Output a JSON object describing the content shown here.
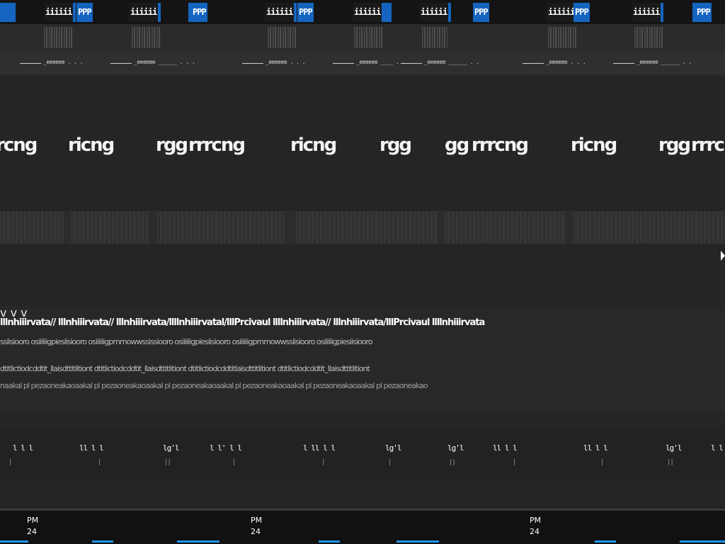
{
  "tabs": [
    {
      "label": "iiiiii"
    },
    {
      "label": "PPP"
    },
    {
      "label": "iiiiii"
    },
    {
      "label": "PPP"
    },
    {
      "label": "iiiiii"
    },
    {
      "label": "PPP"
    },
    {
      "label": "iiiiii"
    },
    {
      "label": "iiiiii"
    },
    {
      "label": "PPP"
    },
    {
      "label": "iiiiii"
    },
    {
      "label": "PPP"
    },
    {
      "label": "iiiiii"
    },
    {
      "label": "PPP"
    }
  ],
  "meta_labels": [
    "_eeeeee",
    "_eeeeee",
    "_eeeeee",
    "_eeeeee",
    "_eeeeee",
    "_eeeeee",
    "_eeeeee"
  ],
  "headline_words": [
    "rcng",
    "ricng",
    "rgg",
    "rrrcng",
    "ricng",
    "rgg",
    "gg",
    "rrrcng",
    "ricng",
    "rgg",
    "rrrcng"
  ],
  "listing": {
    "row1": "lllnhiiirvata// lllnhiiirvata// lllnhiiirvata/llllnhiiirvatal/lllPrcivaul llllnhiiirvata// lllnhiiirvata/lllPrcivaul llllnhiiirvata",
    "row2": "ssiisiooro osiiiiiigpiesiisiooro osiiiiiigpmmowwssissiooro osiiiiiigpiesiisiooro osiiiiiigpmmowwssiisiooro osiiiiiigpiesiisiooro",
    "row3": "dtitlictiodcddtit_llaisdttitlitiont dtitlictiodcddtit_llaisdttitlitiont dtitlictiodcddtitlaisdttitlitiont dtitlictiodcddtit_llaisdttitlitiont",
    "row4": "naakal pl pezaoneakaoaakal pl pezaoneakaoaakal pl pezaoneakaoaakal pl pezaoneakaoaakal pl pezaoneakaoaakal pl pezaoneakao",
    "chevron": "v"
  },
  "ticks": [
    "l l l",
    "ll l l",
    "lg'l",
    "l l' l l",
    "l ll l l",
    "lg'l",
    "lg'l",
    "ll l l",
    "ll l l",
    "lg'l",
    "l l"
  ],
  "clocks": [
    {
      "time": "PM",
      "date": "24"
    },
    {
      "time": "PM",
      "date": "24"
    },
    {
      "time": "PM",
      "date": "24"
    }
  ],
  "colors": {
    "accent": "#1565c0",
    "taskbar_indicator": "#2196f3",
    "background": "#1e1e1e"
  }
}
